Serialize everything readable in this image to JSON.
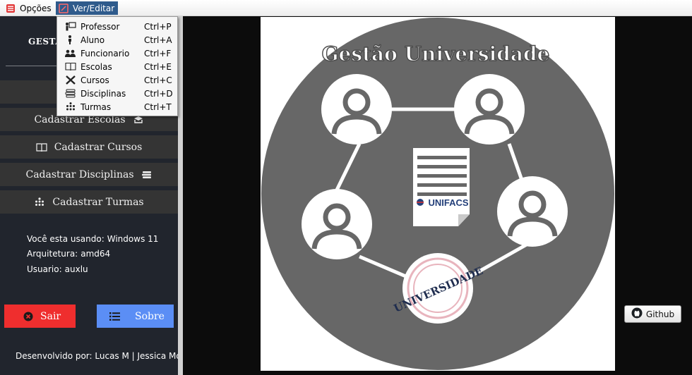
{
  "menubar": {
    "opcoes": {
      "label": "Opções",
      "icon": "list-icon"
    },
    "editar": {
      "label": "Ver/Editar",
      "icon": "edit-icon"
    }
  },
  "dropdown": {
    "items": [
      {
        "label": "Professor",
        "shortcut": "Ctrl+P",
        "icon": "teacher-icon"
      },
      {
        "label": "Aluno",
        "shortcut": "Ctrl+A",
        "icon": "student-icon"
      },
      {
        "label": "Funcionario",
        "shortcut": "Ctrl+F",
        "icon": "group-icon"
      },
      {
        "label": "Escolas",
        "shortcut": "Ctrl+E",
        "icon": "book-icon"
      },
      {
        "label": "Cursos",
        "shortcut": "Ctrl+C",
        "icon": "tools-icon"
      },
      {
        "label": "Disciplinas",
        "shortcut": "Ctrl+D",
        "icon": "stack-books-icon"
      },
      {
        "label": "Turmas",
        "shortcut": "Ctrl+T",
        "icon": "class-icon"
      }
    ]
  },
  "sidebar": {
    "title": "GESTA",
    "buttons": [
      {
        "label": "",
        "icon": "hierarchy-icon"
      },
      {
        "label": "Cadastrar Escolas",
        "icon": "school-icon"
      },
      {
        "label": "Cadastrar Cursos",
        "icon": "book-icon"
      },
      {
        "label": "Cadastrar Disciplinas",
        "icon": "stack-books-icon"
      },
      {
        "label": "Cadastrar Turmas",
        "icon": "class-icon"
      }
    ],
    "info": {
      "os_label": "Você esta usando:",
      "os_value": "Windows 11",
      "arch_label": "Arquitetura:",
      "arch_value": "amd64",
      "user_label": "Usuario:",
      "user_value": "auxlu"
    },
    "sair_label": "Sair",
    "sobre_label": "Sobre",
    "credits": "Desenvolvido por: Lucas M | Jessica Mota"
  },
  "logo": {
    "title": "Gestão Universidade",
    "doc_brand": "UNIFACS",
    "stamp": "UNIVERSIDADE"
  },
  "github": {
    "label": "Github"
  },
  "colors": {
    "sidebar_bg": "#21252d",
    "sidebar_button": "#343434",
    "sair": "#ef2e2e",
    "sobre": "#5b8ef5",
    "menu_active": "#2f5b8c",
    "logo_circle": "#676767"
  }
}
